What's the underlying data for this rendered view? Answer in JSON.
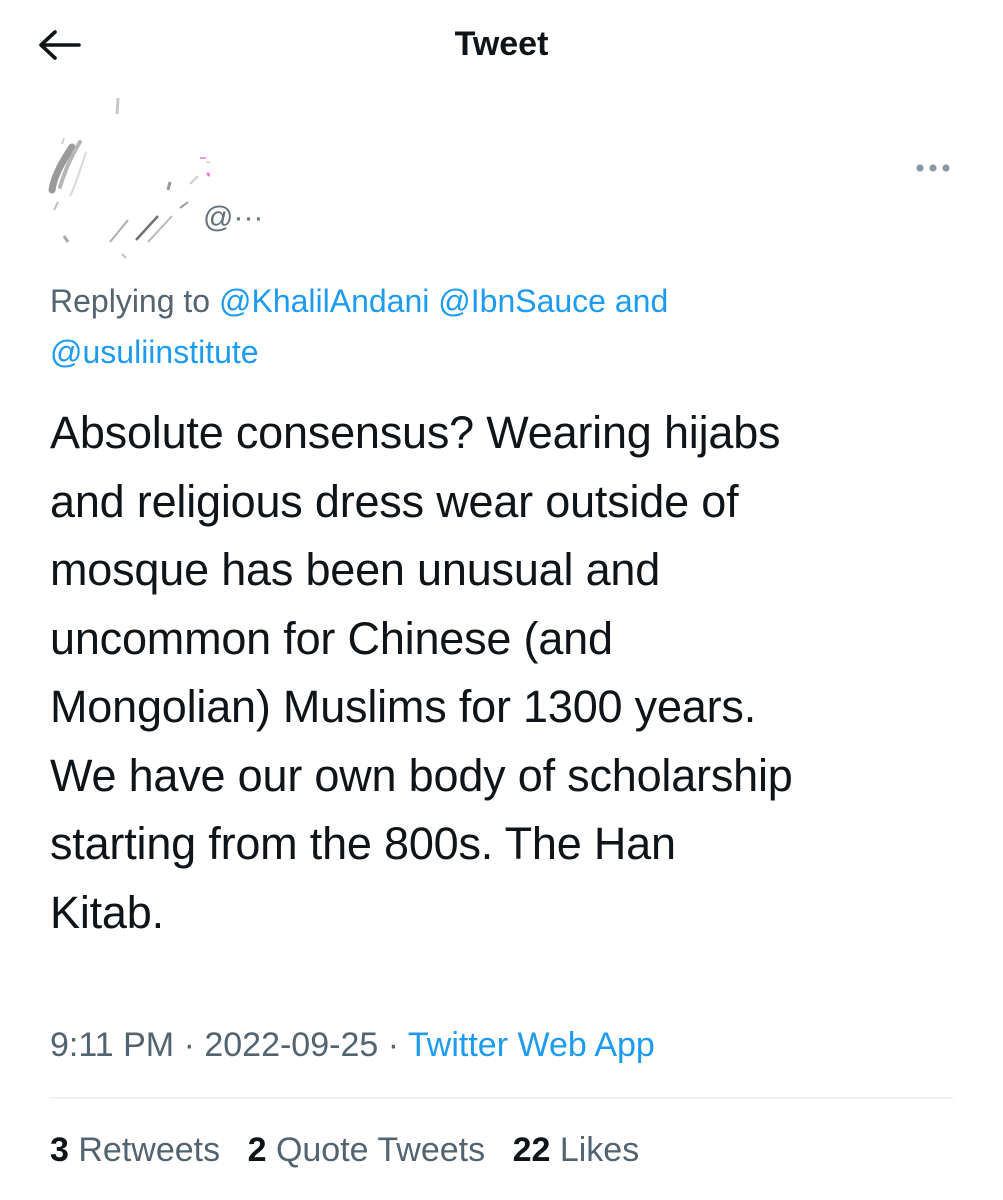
{
  "header": {
    "title": "Tweet",
    "back_icon": "arrow-left-icon"
  },
  "author": {
    "handle": "@···",
    "avatar_icon": "redacted-avatar-scribble"
  },
  "more_icon": "more-dots-icon",
  "reply": {
    "prefix": "Replying to ",
    "mention_1": "@KhalilAndani",
    "mention_2": "@IbnSauce",
    "conjunction": "and",
    "mention_3": "@usuliinstitute"
  },
  "tweet": {
    "lines": [
      "Absolute consensus? Wearing hijabs",
      "and religious dress wear outside of",
      "mosque has been unusual and",
      "uncommon for Chinese (and",
      "Mongolian) Muslims for 1300 years.",
      "We have our own body of scholarship",
      "starting from the 800s. The Han",
      "Kitab."
    ]
  },
  "meta": {
    "time": "9:11 PM",
    "separator": "·",
    "date": "2022-09-25",
    "source": "Twitter Web App"
  },
  "stats": {
    "retweets_count": "3",
    "retweets_label": "Retweets",
    "quotes_count": "2",
    "quotes_label": "Quote Tweets",
    "likes_count": "22",
    "likes_label": "Likes"
  },
  "colors": {
    "text": "#0f1419",
    "secondary": "#536471",
    "link": "#1d9bf0",
    "divider": "#eff3f4"
  }
}
